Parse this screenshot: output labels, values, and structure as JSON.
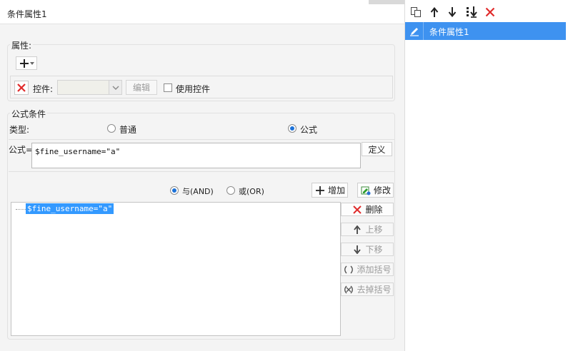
{
  "title": "条件属性1",
  "attributes": {
    "group_label": "属性:",
    "control_label": "控件:",
    "control_select_value": "",
    "edit_label": "编辑",
    "use_control_label": "使用控件"
  },
  "formula_condition": {
    "group_label": "公式条件",
    "type_label": "类型:",
    "type_options": [
      "普通",
      "公式"
    ],
    "selected_type": "公式",
    "formula_label": "公式=",
    "formula_value": "$fine_username=\"a\"",
    "define_label": "定义",
    "and_label": "与(AND)",
    "or_label": "或(OR)",
    "add_label": "增加",
    "modify_label": "修改",
    "conditions": [
      "$fine_username=\"a\""
    ],
    "delete_label": "删除",
    "move_up_label": "上移",
    "move_down_label": "下移",
    "add_bracket_label": "添加括号",
    "remove_bracket_label": "去掉括号"
  },
  "right_pane": {
    "items": [
      {
        "label": "条件属性1",
        "selected": true
      }
    ]
  },
  "colors": {
    "accent": "#3e92f0",
    "delete_red": "#e02b2b",
    "radio_blue": "#1d72d8",
    "selection": "#3399ff"
  }
}
